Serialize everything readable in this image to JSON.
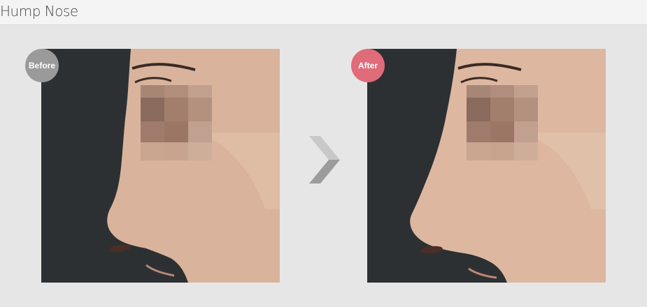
{
  "header": {
    "title": "Hump Nose"
  },
  "before": {
    "label": "Before",
    "badge_color": "#9a9a9a"
  },
  "after": {
    "label": "After",
    "badge_color": "#e06b79"
  },
  "arrow": {
    "icon": "chevron-right-icon"
  }
}
